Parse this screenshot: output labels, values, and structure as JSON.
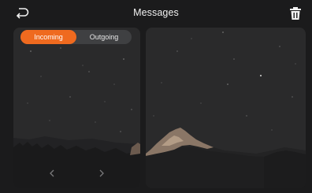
{
  "header": {
    "title": "Messages",
    "back_icon": "back-arrow-icon",
    "delete_icon": "trash-icon"
  },
  "tabs": [
    {
      "label": "Incoming",
      "active": true
    },
    {
      "label": "Outgoing",
      "active": false
    }
  ],
  "pager": {
    "prev_icon": "chevron-left-icon",
    "next_icon": "chevron-right-icon"
  },
  "colors": {
    "accent": "#ef6a1f",
    "background": "#1b1b1c",
    "panel": "#2a2a2b"
  }
}
